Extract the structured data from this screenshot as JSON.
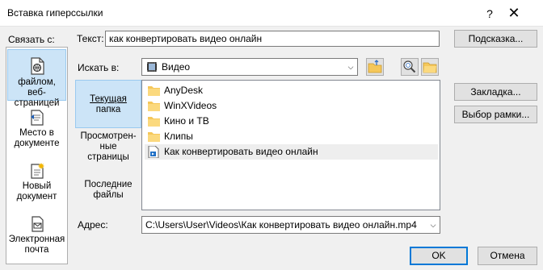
{
  "window": {
    "title": "Вставка гиперссылки",
    "help": "?",
    "close": "✕"
  },
  "link_to": {
    "label": "Связать с:",
    "items": [
      {
        "label": "файлом, веб-страницей",
        "lines": [
          "файлом, веб-",
          "страницей"
        ],
        "selected": true,
        "icon": "file-web-icon"
      },
      {
        "label": "Место в документе",
        "lines": [
          "Место в",
          "документе"
        ],
        "icon": "place-in-document-icon"
      },
      {
        "label": "Новый документ",
        "lines": [
          "Новый",
          "документ"
        ],
        "icon": "new-document-icon"
      },
      {
        "label": "Электронная почта",
        "lines": [
          "Электронная",
          "почта"
        ],
        "icon": "email-icon"
      }
    ]
  },
  "text_row": {
    "label": "Текст:",
    "value": "как конвертировать видео онлайн",
    "tooltip_button": "Подсказка..."
  },
  "look_in": {
    "label": "Искать в:",
    "value": "Видео",
    "icons": [
      "folder-up-icon",
      "browse-web-icon",
      "browse-file-icon"
    ]
  },
  "nav": [
    {
      "label": "Текущая папка",
      "lines": [
        "Текущая",
        "папка"
      ],
      "selected": true
    },
    {
      "label": "Просмотренные страницы",
      "lines": [
        "Просмотрен-",
        "ные",
        "страницы"
      ]
    },
    {
      "label": "Последние файлы",
      "lines": [
        "Последние",
        "файлы"
      ]
    }
  ],
  "files": [
    {
      "name": "AnyDesk",
      "type": "folder"
    },
    {
      "name": "WinXVideos",
      "type": "folder"
    },
    {
      "name": "Кино и ТВ",
      "type": "folder"
    },
    {
      "name": "Клипы",
      "type": "folder"
    },
    {
      "name": "Как конвертировать видео онлайн",
      "type": "document",
      "selected": true
    }
  ],
  "right_buttons": {
    "bookmark": "Закладка...",
    "frame": "Выбор рамки..."
  },
  "address": {
    "label": "Адрес:",
    "value": "C:\\Users\\User\\Videos\\Как конвертировать видео онлайн.mp4"
  },
  "footer": {
    "ok": "OK",
    "cancel": "Отмена"
  }
}
